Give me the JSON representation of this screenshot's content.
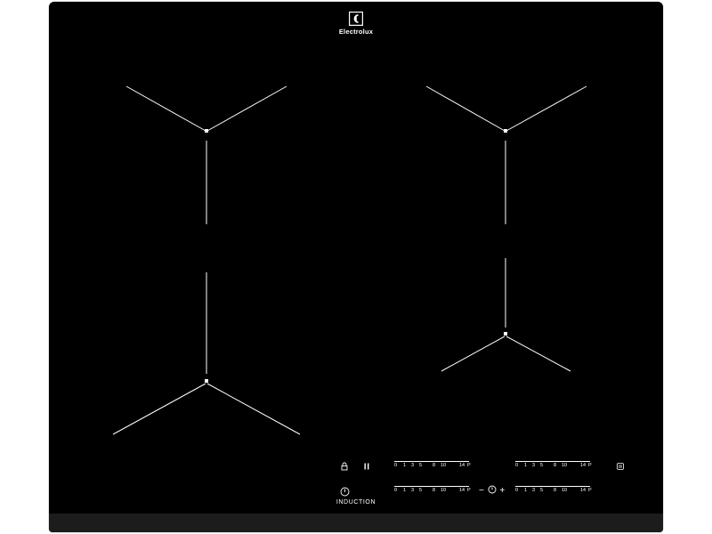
{
  "brand": {
    "name": "Electrolux",
    "logo_icon": "electrolux-logo-icon"
  },
  "controls": {
    "lock_icon": "lock-icon",
    "pause_icon": "pause-icon",
    "power_icon": "power-icon",
    "bridge_icon": "bridge-icon",
    "induction_label": "INDUCTION",
    "timer": {
      "minus": "−",
      "plus": "+",
      "clock_icon": "timer-clock-icon"
    }
  },
  "power_scales": [
    {
      "id": "top-left",
      "labels": [
        "0",
        "1",
        "3",
        "5",
        "8",
        "10",
        "14",
        "P"
      ]
    },
    {
      "id": "top-right",
      "labels": [
        "0",
        "1",
        "3",
        "5",
        "8",
        "10",
        "14",
        "P"
      ]
    },
    {
      "id": "bottom-left",
      "labels": [
        "0",
        "1",
        "3",
        "5",
        "8",
        "10",
        "14",
        "P"
      ]
    },
    {
      "id": "bottom-right",
      "labels": [
        "0",
        "1",
        "3",
        "5",
        "8",
        "10",
        "14",
        "P"
      ]
    }
  ],
  "colors": {
    "hob": "#000000",
    "markings": "#ffffff",
    "edge": "#1c1c1c"
  }
}
